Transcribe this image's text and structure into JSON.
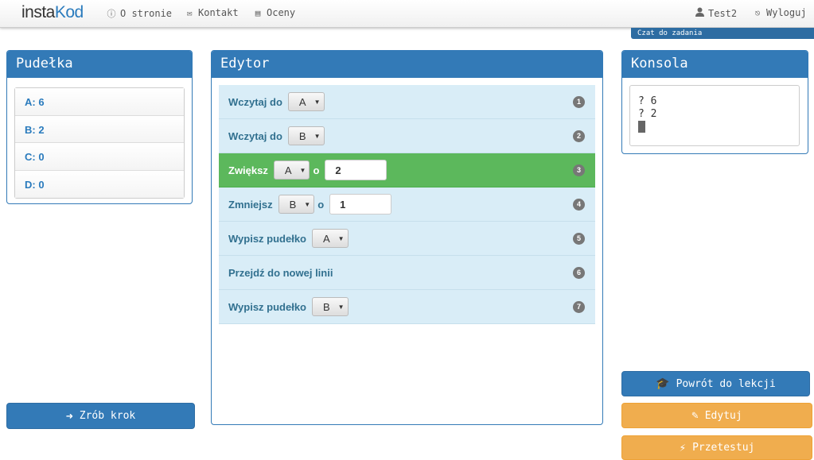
{
  "navbar": {
    "brand_prefix": "insta",
    "brand_suffix": "Kod",
    "items": [
      {
        "label": "O stronie",
        "icon": "info-icon"
      },
      {
        "label": "Kontakt",
        "icon": "envelope-icon"
      },
      {
        "label": "Oceny",
        "icon": "list-icon"
      }
    ],
    "user": {
      "label": "Test2",
      "icon": "user-icon"
    },
    "logout": {
      "label": "Wyloguj",
      "icon": "logout-icon"
    },
    "chat_tab": "Czat do zadania"
  },
  "boxes": {
    "title": "Pudełka",
    "items": [
      "A: 6",
      "B: 2",
      "C: 0",
      "D: 0"
    ],
    "step_button": "Zrób krok"
  },
  "editor": {
    "title": "Edytor",
    "lines": [
      {
        "num": "1",
        "text": "Wczytaj do",
        "select": "A"
      },
      {
        "num": "2",
        "text": "Wczytaj do",
        "select": "B"
      },
      {
        "num": "3",
        "text": "Zwiększ",
        "select": "A",
        "mid": "o",
        "input": "2",
        "active": true
      },
      {
        "num": "4",
        "text": "Zmniejsz",
        "select": "B",
        "mid": "o",
        "input": "1"
      },
      {
        "num": "5",
        "text": "Wypisz pudełko",
        "select": "A"
      },
      {
        "num": "6",
        "text": "Przejdź do nowej linii"
      },
      {
        "num": "7",
        "text": "Wypisz pudełko",
        "select": "B"
      }
    ]
  },
  "console": {
    "title": "Konsola",
    "lines": [
      "? 6",
      "? 2"
    ]
  },
  "actions": {
    "back": "Powrót do lekcji",
    "edit": "Edytuj",
    "test": "Przetestuj"
  },
  "colors": {
    "primary": "#337ab7",
    "success": "#5cb85c",
    "warning": "#f0ad4e",
    "editor_line": "#d9edf7"
  }
}
